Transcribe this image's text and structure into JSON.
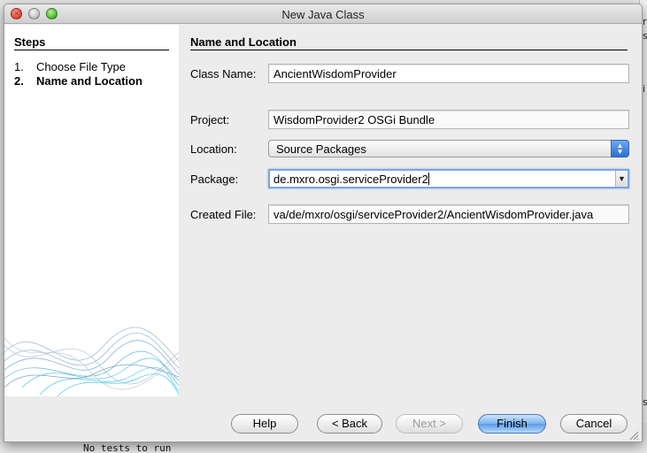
{
  "background": {
    "right_fragments": [
      "ro",
      "s",
      "i",
      "s"
    ],
    "console_line": "No tests to run"
  },
  "window": {
    "title": "New Java Class"
  },
  "steps": {
    "heading": "Steps",
    "items": [
      {
        "num": "1.",
        "label": "Choose File Type"
      },
      {
        "num": "2.",
        "label": "Name and Location"
      }
    ]
  },
  "form": {
    "heading": "Name and Location",
    "class_name": {
      "label": "Class Name:",
      "value": "AncientWisdomProvider"
    },
    "project": {
      "label": "Project:",
      "value": "WisdomProvider2 OSGi Bundle"
    },
    "location": {
      "label": "Location:",
      "value": "Source Packages"
    },
    "package": {
      "label": "Package:",
      "value": "de.mxro.osgi.serviceProvider2"
    },
    "created_file": {
      "label": "Created File:",
      "value": "va/de/mxro/osgi/serviceProvider2/AncientWisdomProvider.java"
    }
  },
  "buttons": {
    "help": "Help",
    "back": "< Back",
    "next": "Next >",
    "finish": "Finish",
    "cancel": "Cancel"
  },
  "icons": {
    "close": "close-icon",
    "minimize": "minimize-icon",
    "zoom": "zoom-icon",
    "dropdown": "chevron-updown-icon",
    "resize": "resize-grip-icon"
  }
}
